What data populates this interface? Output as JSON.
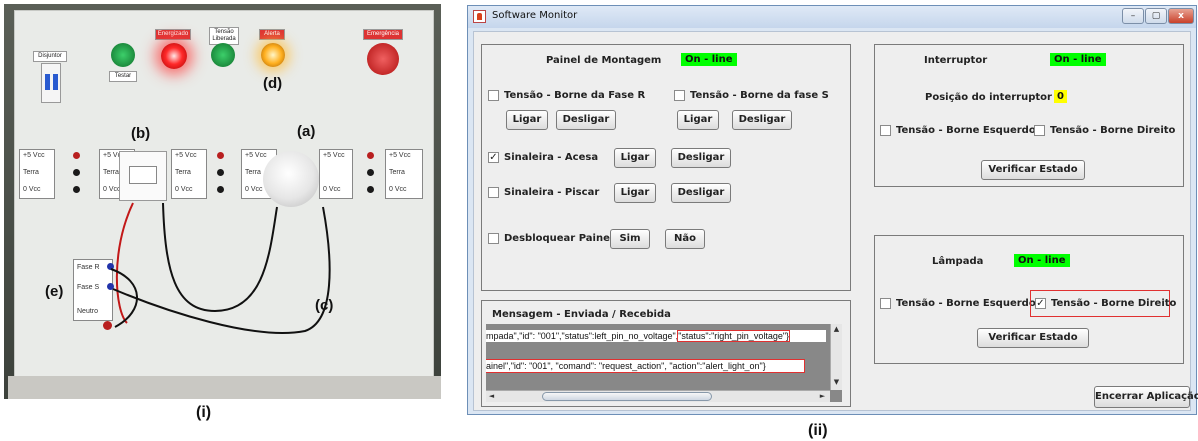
{
  "photo": {
    "labels": {
      "disjuntor": "Disjuntor",
      "testar": "Testar",
      "energizado": "Energizado",
      "tensao_liberada": "Tensão Liberada",
      "alerta": "Alerta",
      "emergencia": "Emergência"
    },
    "pinbox": {
      "vcc": "+5 Vcc",
      "terra": "Terra",
      "zero_vcc": "0 Vcc"
    },
    "phase_labels": {
      "fase_r": "Fase R",
      "fase_s": "Fase S",
      "neutro": "Neutro"
    },
    "markers": {
      "a": "(a)",
      "b": "(b)",
      "c": "(c)",
      "d": "(d)",
      "e": "(e)"
    },
    "caption": "(i)"
  },
  "caption_ii": "(ii)",
  "window": {
    "title": "Software Monitor",
    "controls": {
      "minimize": "–",
      "maximize": "▢",
      "close": "x"
    }
  },
  "painel": {
    "title": "Painel de Montagem",
    "status": "On - line",
    "tensao_r": "Tensão - Borne da Fase R",
    "tensao_s": "Tensão - Borne da fase S",
    "ligar": "Ligar",
    "desligar": "Desligar",
    "sinaleira_acesa": "Sinaleira - Acesa",
    "sinaleira_piscar": "Sinaleira - Piscar",
    "desbloquear": "Desbloquear Painel",
    "sim": "Sim",
    "nao": "Não"
  },
  "mensagem": {
    "title": "Mensagem - Enviada / Recebida",
    "line1_a": "mpada\",\"id\": \"001\",\"status\":left_pin_no_voltage\",",
    "line1_b": "\"status\":\"right_pin_voltage\"}",
    "line2": "ainel\",\"id\": \"001\", \"comand\": \"request_action\", \"action\":\"alert_light_on\"}"
  },
  "interruptor": {
    "title": "Interruptor",
    "status": "On - line",
    "posicao_label": "Posição do interruptor",
    "posicao_value": "0",
    "esquerdo": "Tensão - Borne Esquerdo",
    "direito": "Tensão - Borne Direito",
    "verificar": "Verificar Estado"
  },
  "lampada": {
    "title": "Lâmpada",
    "status": "On - line",
    "esquerdo": "Tensão - Borne Esquerdo",
    "direito": "Tensão - Borne Direito",
    "verificar": "Verificar Estado"
  },
  "encerrar": "Encerrar Aplicação",
  "checkbox_states": {
    "tensao_r": false,
    "tensao_s": false,
    "sinaleira_acesa": true,
    "sinaleira_piscar": false,
    "desbloquear": false,
    "interruptor_esquerdo": false,
    "interruptor_direito": false,
    "lampada_esquerdo": false,
    "lampada_direito": true
  },
  "colors": {
    "online_green": "#00ff00",
    "position_yellow": "#ffff00",
    "highlight_red": "#e03030"
  }
}
